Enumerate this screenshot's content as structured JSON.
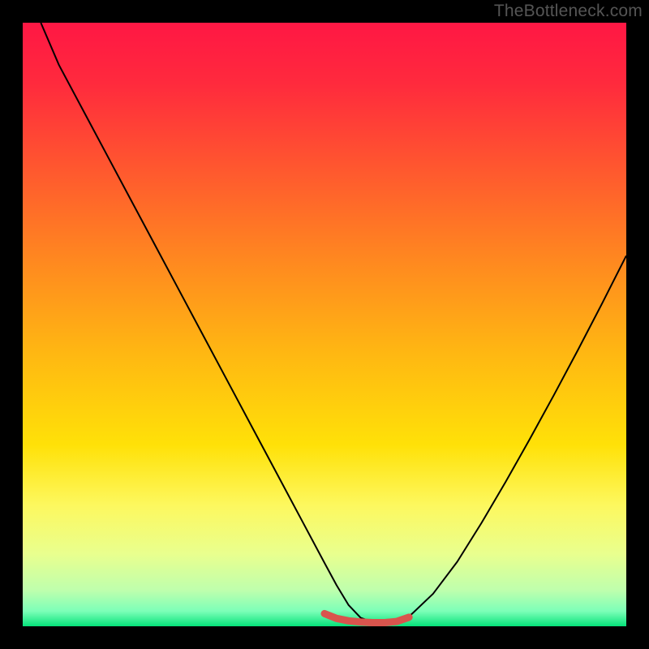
{
  "watermark": "TheBottleneck.com",
  "chart_data": {
    "type": "line",
    "title": "",
    "xlabel": "",
    "ylabel": "",
    "xlim": [
      0,
      100
    ],
    "ylim": [
      0,
      100
    ],
    "grid": false,
    "legend": false,
    "gradient_stops": [
      {
        "offset": 0.0,
        "color": "#ff1744"
      },
      {
        "offset": 0.1,
        "color": "#ff2a3d"
      },
      {
        "offset": 0.25,
        "color": "#ff5a2e"
      },
      {
        "offset": 0.4,
        "color": "#ff8a1f"
      },
      {
        "offset": 0.55,
        "color": "#ffb812"
      },
      {
        "offset": 0.7,
        "color": "#ffe108"
      },
      {
        "offset": 0.8,
        "color": "#fdf85f"
      },
      {
        "offset": 0.88,
        "color": "#e9ff8e"
      },
      {
        "offset": 0.94,
        "color": "#bfffad"
      },
      {
        "offset": 0.975,
        "color": "#7cffb8"
      },
      {
        "offset": 1.0,
        "color": "#05e27a"
      }
    ],
    "series": [
      {
        "name": "bottleneck-curve",
        "color": "#000000",
        "stroke_width": 2,
        "x": [
          3,
          6,
          10,
          14,
          18,
          22,
          26,
          30,
          34,
          38,
          42,
          46,
          50,
          52,
          54,
          56,
          58,
          60,
          62,
          64,
          68,
          72,
          76,
          80,
          84,
          88,
          92,
          96,
          100
        ],
        "y": [
          100,
          93,
          85.5,
          78,
          70.5,
          63,
          55.5,
          48,
          40.5,
          33,
          25.5,
          18,
          10.5,
          6.8,
          3.5,
          1.4,
          0.7,
          0.6,
          0.7,
          1.6,
          5.4,
          10.7,
          17.1,
          23.9,
          31.0,
          38.3,
          45.8,
          53.5,
          61.4
        ]
      },
      {
        "name": "highlight-band",
        "color": "#d9544d",
        "stroke_width": 9,
        "linecap": "round",
        "x": [
          50,
          52,
          54,
          56,
          58,
          60,
          62,
          64
        ],
        "y": [
          2.1,
          1.3,
          0.9,
          0.7,
          0.6,
          0.6,
          0.8,
          1.5
        ]
      }
    ],
    "annotations": []
  }
}
